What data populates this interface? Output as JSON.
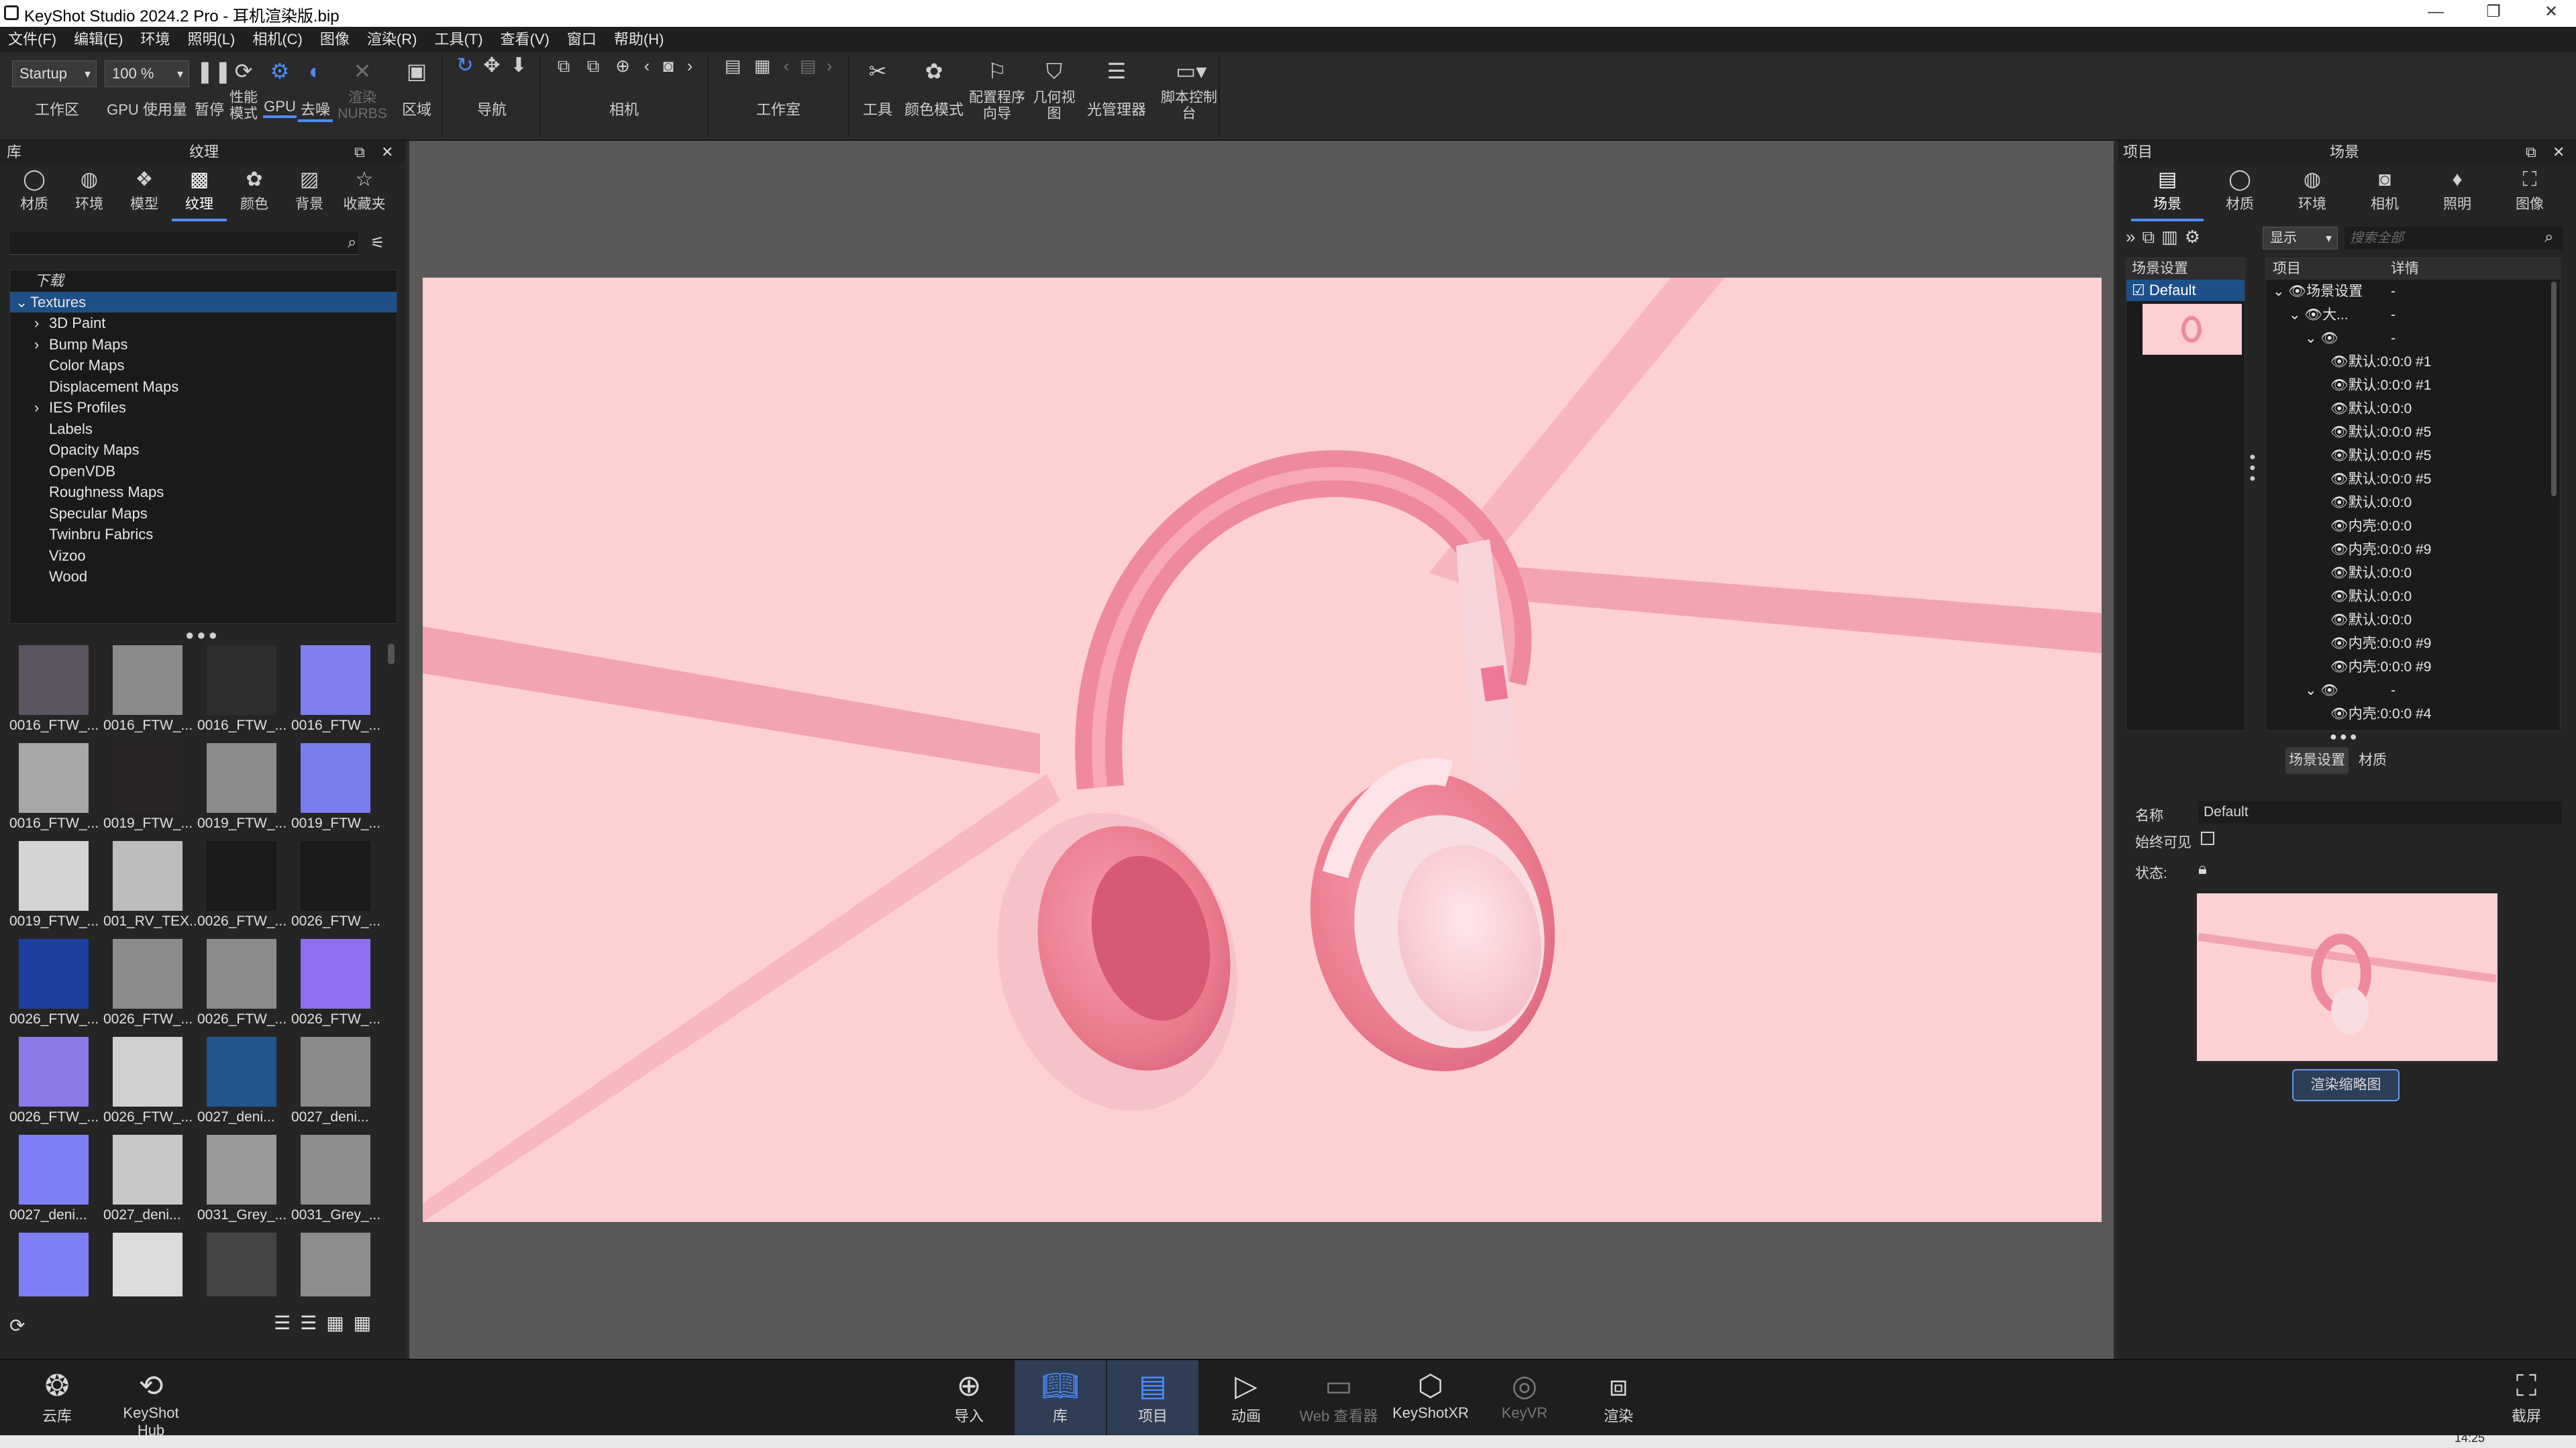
{
  "app": {
    "title": "KeyShot Studio 2024.2 Pro - 耳机渲染版.bip",
    "window_controls": [
      "—",
      "❐",
      "✕"
    ]
  },
  "menu": [
    "文件(F)",
    "编辑(E)",
    "环境",
    "照明(L)",
    "相机(C)",
    "图像",
    "渲染(R)",
    "工具(T)",
    "查看(V)",
    "窗口",
    "帮助(H)"
  ],
  "toolbar": {
    "workspace_value": "Startup",
    "zoom_value": "100 %",
    "workspace_label": "工作区",
    "gpu_usage_label": "GPU 使用量",
    "pause_label": "暂停",
    "perf_mode_label": "性能模式",
    "gpu_label": "GPU",
    "denoise_label": "去噪",
    "render_nurbs_label": "渲染NURBS",
    "region_label": "区域",
    "navigate_label": "导航",
    "camera_label": "相机",
    "studio_label": "工作室",
    "tools_label": "工具",
    "color_mode_label": "颜色模式",
    "config_wizard_label": "配置程序向导",
    "geometry_view_label": "几何视图",
    "light_manager_label": "光管理器",
    "script_console_label": "脚本控制台"
  },
  "library": {
    "header_left": "库",
    "header_center": "纹理",
    "tabs": [
      "材质",
      "环境",
      "模型",
      "纹理",
      "颜色",
      "背景",
      "收藏夹"
    ],
    "active_tab": "纹理",
    "download_label": "下载",
    "tree": [
      {
        "label": "Textures",
        "expanded": true,
        "selected": true,
        "level": 0
      },
      {
        "label": "3D Paint",
        "expandable": true,
        "level": 1
      },
      {
        "label": "Bump Maps",
        "expandable": true,
        "level": 1
      },
      {
        "label": "Color Maps",
        "level": 1
      },
      {
        "label": "Displacement Maps",
        "level": 1
      },
      {
        "label": "IES Profiles",
        "expandable": true,
        "level": 1
      },
      {
        "label": "Labels",
        "level": 1
      },
      {
        "label": "Opacity Maps",
        "level": 1
      },
      {
        "label": "OpenVDB",
        "level": 1
      },
      {
        "label": "Roughness Maps",
        "level": 1
      },
      {
        "label": "Specular Maps",
        "level": 1
      },
      {
        "label": "Twinbru Fabrics",
        "level": 1
      },
      {
        "label": "Vizoo",
        "level": 1
      },
      {
        "label": "Wood",
        "level": 1
      }
    ],
    "thumbnails": [
      {
        "caption": "0016_FTW_...",
        "color": "#5a5560"
      },
      {
        "caption": "0016_FTW_...",
        "color": "#8a8a8a"
      },
      {
        "caption": "0016_FTW_...",
        "color": "#2e2e2e"
      },
      {
        "caption": "0016_FTW_...",
        "color": "#7f7ff2"
      },
      {
        "caption": "0016_FTW_...",
        "color": "#a8a8a8"
      },
      {
        "caption": "0019_FTW_...",
        "color": "#2a2626"
      },
      {
        "caption": "0019_FTW_...",
        "color": "#8b8b8b"
      },
      {
        "caption": "0019_FTW_...",
        "color": "#7b7bf0"
      },
      {
        "caption": "0019_FTW_...",
        "color": "#d4d4d4"
      },
      {
        "caption": "001_RV_TEX...",
        "color": "#bdbdbd"
      },
      {
        "caption": "0026_FTW_...",
        "color": "#1a1a1a"
      },
      {
        "caption": "0026_FTW_...",
        "color": "#1a1a1a"
      },
      {
        "caption": "0026_FTW_...",
        "color": "#1c3fa0"
      },
      {
        "caption": "0026_FTW_...",
        "color": "#8c8c8c"
      },
      {
        "caption": "0026_FTW_...",
        "color": "#8c8c8c"
      },
      {
        "caption": "0026_FTW_...",
        "color": "#8f6ff0"
      },
      {
        "caption": "0026_FTW_...",
        "color": "#8a79e6"
      },
      {
        "caption": "0026_FTW_...",
        "color": "#cfcfcf"
      },
      {
        "caption": "0027_deni...",
        "color": "#23548c"
      },
      {
        "caption": "0027_deni...",
        "color": "#8a8a8a"
      },
      {
        "caption": "0027_deni...",
        "color": "#7f7ff5"
      },
      {
        "caption": "0027_deni...",
        "color": "#c8c8c8"
      },
      {
        "caption": "0031_Grey_...",
        "color": "#9a9a9a"
      },
      {
        "caption": "0031_Grey_...",
        "color": "#8e8e8e"
      },
      {
        "caption": "",
        "color": "#7f7ff5"
      },
      {
        "caption": "",
        "color": "#dcdcdc"
      },
      {
        "caption": "",
        "color": "#444444"
      },
      {
        "caption": "",
        "color": "#8d8d8d"
      }
    ]
  },
  "project": {
    "header_left": "项目",
    "header_center": "场景",
    "tabs": [
      "场景",
      "材质",
      "环境",
      "相机",
      "照明",
      "图像"
    ],
    "active_tab": "场景",
    "display_combo": "显示",
    "search_placeholder": "搜索全部",
    "left_col_header": "场景设置",
    "default_item": "Default",
    "tree_headers": [
      "项目",
      "详情"
    ],
    "outline": [
      {
        "label": "场景设置",
        "detail": "-",
        "indent": 0
      },
      {
        "label": "大...",
        "detail": "-",
        "indent": 1
      },
      {
        "label": "",
        "detail": "-",
        "indent": 2
      },
      {
        "label": "默认:0:0:0 #1",
        "detail": "",
        "indent": 3
      },
      {
        "label": "默认:0:0:0 #1",
        "detail": "",
        "indent": 3
      },
      {
        "label": "默认:0:0:0",
        "detail": "",
        "indent": 3
      },
      {
        "label": "默认:0:0:0 #5",
        "detail": "",
        "indent": 3
      },
      {
        "label": "默认:0:0:0 #5",
        "detail": "",
        "indent": 3
      },
      {
        "label": "默认:0:0:0 #5",
        "detail": "",
        "indent": 3
      },
      {
        "label": "默认:0:0:0",
        "detail": "",
        "indent": 3
      },
      {
        "label": "内壳:0:0:0",
        "detail": "",
        "indent": 3
      },
      {
        "label": "内壳:0:0:0 #9",
        "detail": "",
        "indent": 3
      },
      {
        "label": "默认:0:0:0",
        "detail": "",
        "indent": 3
      },
      {
        "label": "默认:0:0:0",
        "detail": "",
        "indent": 3
      },
      {
        "label": "默认:0:0:0",
        "detail": "",
        "indent": 3
      },
      {
        "label": "内壳:0:0:0 #9",
        "detail": "",
        "indent": 3
      },
      {
        "label": "内壳:0:0:0 #9",
        "detail": "",
        "indent": 3
      },
      {
        "label": "",
        "detail": "-",
        "indent": 2
      },
      {
        "label": "内壳:0:0:0 #4",
        "detail": "",
        "indent": 3
      }
    ],
    "sub_tabs": [
      "场景设置",
      "材质"
    ],
    "active_sub_tab": "场景设置",
    "name_label": "名称",
    "name_value": "Default",
    "always_visible_label": "始终可见",
    "state_label": "状态:",
    "render_thumb_button": "渲染缩略图"
  },
  "bottom_bar": {
    "cloud_label": "云库",
    "hub_label": "KeyShot Hub",
    "items": [
      "导入",
      "库",
      "项目",
      "动画",
      "Web 查看器",
      "KeyShotXR",
      "KeyVR",
      "渲染"
    ],
    "active": [
      "库",
      "项目"
    ],
    "screenshot_label": "截屏"
  },
  "taskbar_clock": "14:25",
  "colors": {
    "accent": "#4d8dff",
    "background_pink": "#fdd0d2",
    "headphone_pink": "#f08898",
    "selection": "#1e4f86"
  }
}
